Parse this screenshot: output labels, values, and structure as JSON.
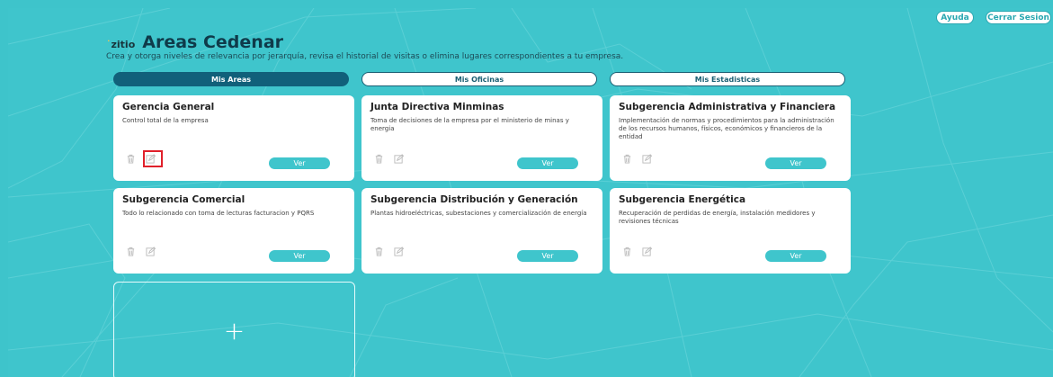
{
  "header": {
    "ayuda_label": "Ayuda",
    "logout_label": "Cerrar Sesion",
    "logo_text": "zitio",
    "title": "Areas Cedenar",
    "subtitle": "Crea y otorga niveles de relevancia por jerarquía, revisa el historial de visitas o elimina lugares correspondientes a tu empresa."
  },
  "tabs": [
    {
      "label": "Mis Areas",
      "active": true
    },
    {
      "label": "Mis Oficinas",
      "active": false
    },
    {
      "label": "Mis Estadisticas",
      "active": false
    }
  ],
  "cards": [
    {
      "title": "Gerencia General",
      "desc": "Control total de la empresa",
      "button": "Ver"
    },
    {
      "title": "Junta Directiva Minminas",
      "desc": "Toma de decisiones de la empresa por el ministerio de minas y energia",
      "button": "Ver"
    },
    {
      "title": "Subgerencia Administrativa y Financiera",
      "desc": "Implementación de normas y procedimientos para la administración de los recursos humanos, físicos, económicos y financieros de la entidad",
      "button": "Ver"
    },
    {
      "title": "Subgerencia Comercial",
      "desc": "Todo lo relacionado con toma de lecturas facturacion y PQRS",
      "button": "Ver"
    },
    {
      "title": "Subgerencia Distribución y Generación",
      "desc": "Plantas hidroeléctricas, subestaciones y comercialización de energía",
      "button": "Ver"
    },
    {
      "title": "Subgerencia Energética",
      "desc": "Recuperación de perdidas de energía, instalación medidores y revisiones técnicas",
      "button": "Ver"
    }
  ],
  "add_card": {
    "symbol": "+"
  },
  "icons": {
    "trash": "trash-icon",
    "edit": "edit-icon",
    "add": "plus-icon"
  },
  "colors": {
    "accent": "#3fc5cc",
    "active_tab": "#11607a",
    "highlight": "#e0202a"
  }
}
